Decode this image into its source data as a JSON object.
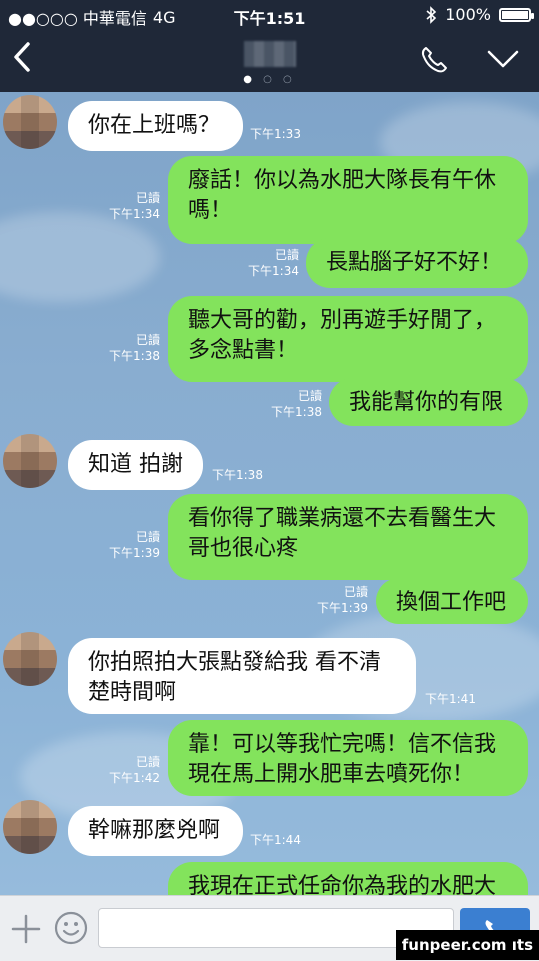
{
  "status_bar": {
    "carrier": "●●○○○ 中華電信",
    "network": "4G",
    "time": "下午1:51",
    "battery_percent": "100%",
    "battery_level": 1.0
  },
  "header": {
    "page_indicator": [
      "●",
      "○",
      "○"
    ],
    "back_icon": "chevron-left-icon",
    "call_icon": "phone-icon",
    "menu_icon": "chevron-down-icon"
  },
  "messages": [
    {
      "side": "in",
      "lines": [
        "你在上班嗎？"
      ],
      "time": "下午1:33"
    },
    {
      "side": "out",
      "lines": [
        "廢話！你以為水肥大隊長有午休",
        "嗎！"
      ],
      "read": "已讀",
      "time": "下午1:34"
    },
    {
      "side": "out",
      "lines": [
        "長點腦子好不好！"
      ],
      "read": "已讀",
      "time": "下午1:34"
    },
    {
      "side": "out",
      "lines": [
        "聽大哥的勸，別再遊手好閒了，",
        "多念點書！"
      ],
      "read": "已讀",
      "time": "下午1:38"
    },
    {
      "side": "out",
      "lines": [
        "我能幫你的有限"
      ],
      "read": "已讀",
      "time": "下午1:38"
    },
    {
      "side": "in",
      "lines": [
        "知道 拍謝"
      ],
      "time": "下午1:38"
    },
    {
      "side": "out",
      "lines": [
        "看你得了職業病還不去看醫生大",
        "哥也很心疼"
      ],
      "read": "已讀",
      "time": "下午1:39"
    },
    {
      "side": "out",
      "lines": [
        "換個工作吧"
      ],
      "read": "已讀",
      "time": "下午1:39"
    },
    {
      "side": "in",
      "lines": [
        "你拍照拍大張點發給我  看不清",
        "楚時間啊"
      ],
      "time": "下午1:41"
    },
    {
      "side": "out",
      "lines": [
        "靠！可以等我忙完嗎！信不信我",
        "現在馬上開水肥車去噴死你！"
      ],
      "read": "已讀",
      "time": "下午1:42"
    },
    {
      "side": "in",
      "lines": [
        "幹嘛那麼兇啊"
      ],
      "time": "下午1:44"
    },
    {
      "side": "out",
      "lines": [
        "我現在正式任命你為我的水肥大"
      ]
    }
  ],
  "input_bar": {
    "plus_icon": "plus-icon",
    "emoji_icon": "smiley-icon",
    "send_icon": "phone-send-icon",
    "placeholder": ""
  },
  "watermark": "funpeer.com ıts",
  "colors": {
    "navbar": "#1f2838",
    "incoming_bubble": "#ffffff",
    "outgoing_bubble": "#83e35c",
    "send_button": "#3b7fd1"
  }
}
